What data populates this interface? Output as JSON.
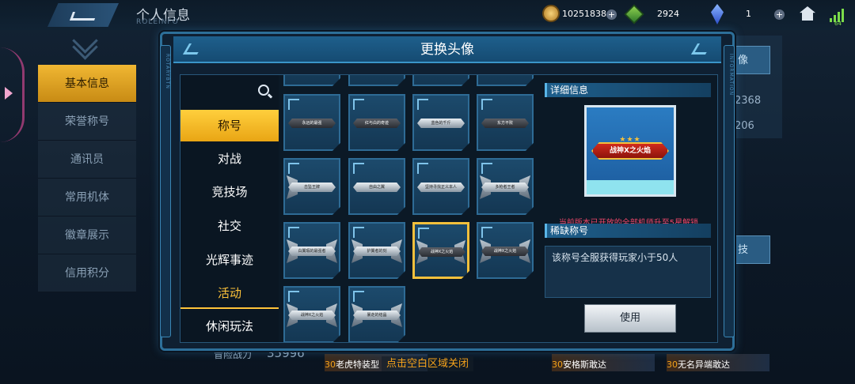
{
  "header": {
    "title": "个人信息",
    "subtitle": "ROLEINFO"
  },
  "currency": {
    "coins": "10251838",
    "cubes": "2924",
    "crystals": "1",
    "plus": "+",
    "signal": "64"
  },
  "leftnav": {
    "items": [
      "基本信息",
      "荣誉称号",
      "通讯员",
      "常用机体",
      "徽章展示",
      "信用积分"
    ]
  },
  "background": {
    "btn1": "像",
    "num1": "2368",
    "num2": "206",
    "btn2": "技",
    "power_label": "冒险战力",
    "power_value": "35996",
    "strips": [
      {
        "level": "30",
        "name": "老虎特装型"
      },
      {
        "level": "30",
        "name": "安格斯敢达"
      },
      {
        "level": "30",
        "name": "无名异端敢达"
      }
    ]
  },
  "modal": {
    "title": "更换头像",
    "side_left": "ROTARYBTN",
    "side_right": "INFORMATION"
  },
  "categories": [
    "称号",
    "对战",
    "竞技场",
    "社交",
    "光辉事迹",
    "活动",
    "休闲玩法"
  ],
  "tiles": [
    "永远的最强",
    "红与白的奇迹",
    "蓝色的千斤",
    "东方不败",
    "击坠王牌",
    "自由之翼",
    "坚持寻找正义本人",
    "多枪者王者",
    "白翼瑕的最强者",
    "护翼者的刻",
    "战神X之火焰",
    "战神X之火焰",
    "战神X之火焰",
    "暴走的结晶"
  ],
  "details": {
    "section1": "详细信息",
    "preview_title": "战神X之火焰",
    "preview_stars": "★★★",
    "warning": "当前版本已开放的全部机师升至5星解锁",
    "section2": "稀缺称号",
    "description": "该称号全服获得玩家小于50人",
    "use_button": "使用"
  },
  "close_hint": "点击空白区域关闭"
}
